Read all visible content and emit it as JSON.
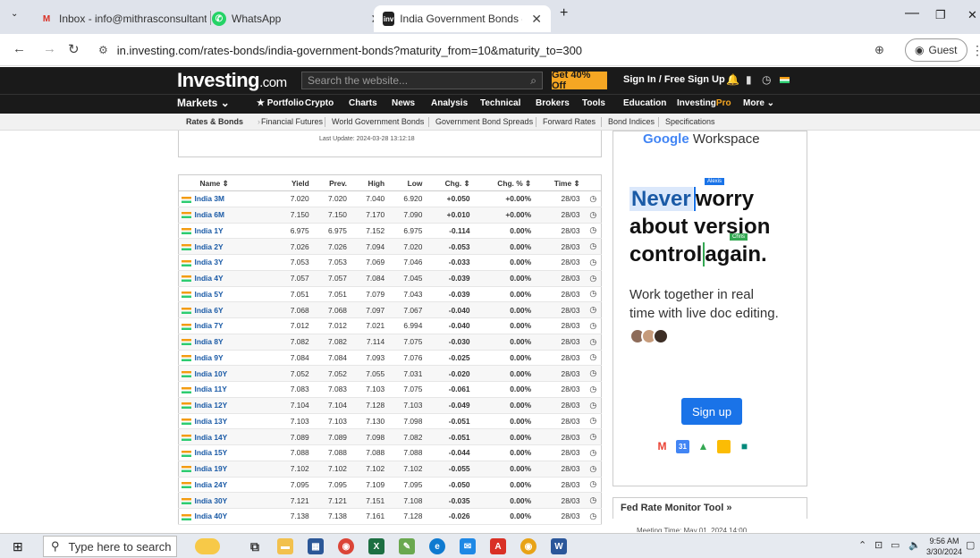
{
  "browser": {
    "tabs": [
      {
        "label": "Inbox - info@mithrasconsultant",
        "icon": "gmail-icon"
      },
      {
        "label": "WhatsApp",
        "icon": "whatsapp-icon"
      },
      {
        "label": "India Government Bonds - Inve",
        "icon": "investing-icon",
        "active": true
      }
    ],
    "new_tab": "+",
    "url": "in.investing.com/rates-bonds/india-government-bonds?maturity_from=10&maturity_to=300",
    "profile": "Guest",
    "window": {
      "minimize": "—",
      "maximize": "❐",
      "close": "✕"
    }
  },
  "site": {
    "logo_main": "Investing",
    "logo_suffix": ".com",
    "search_placeholder": "Search the website...",
    "offer": "Get 40% Off",
    "signin": "Sign In / Free Sign Up",
    "nav": {
      "markets": "Markets ⌄",
      "portfolio": "★ Portfolio",
      "crypto": "Crypto",
      "charts": "Charts",
      "news": "News",
      "analysis": "Analysis",
      "technical": "Technical",
      "brokers": "Brokers",
      "tools": "Tools",
      "education": "Education",
      "investing_pro_a": "Investing",
      "investing_pro_b": "Pro",
      "more": "More ⌄"
    },
    "subnav": [
      "Rates & Bonds",
      "Financial Futures",
      "World Government Bonds",
      "Government Bond Spreads",
      "Forward Rates",
      "Bond Indices",
      "Specifications"
    ],
    "last_update": "Last Update: 2024-03-28 13:12:18"
  },
  "table": {
    "headers": {
      "name": "Name ⇕",
      "yield": "Yield",
      "prev": "Prev.",
      "high": "High",
      "low": "Low",
      "chg": "Chg. ⇕",
      "chgp": "Chg. % ⇕",
      "time": "Time ⇕"
    },
    "rows": [
      {
        "name": "India 3M",
        "yield": "7.020",
        "prev": "7.020",
        "high": "7.040",
        "low": "6.920",
        "chg": "+0.050",
        "chgp": "+0.00%",
        "time": "28/03",
        "dir": "pos"
      },
      {
        "name": "India 6M",
        "yield": "7.150",
        "prev": "7.150",
        "high": "7.170",
        "low": "7.090",
        "chg": "+0.010",
        "chgp": "+0.00%",
        "time": "28/03",
        "dir": "pos"
      },
      {
        "name": "India 1Y",
        "yield": "6.975",
        "prev": "6.975",
        "high": "7.152",
        "low": "6.975",
        "chg": "-0.114",
        "chgp": "0.00%",
        "time": "28/03",
        "dir": "neg"
      },
      {
        "name": "India 2Y",
        "yield": "7.026",
        "prev": "7.026",
        "high": "7.094",
        "low": "7.020",
        "chg": "-0.053",
        "chgp": "0.00%",
        "time": "28/03",
        "dir": "neg"
      },
      {
        "name": "India 3Y",
        "yield": "7.053",
        "prev": "7.053",
        "high": "7.069",
        "low": "7.046",
        "chg": "-0.033",
        "chgp": "0.00%",
        "time": "28/03",
        "dir": "neg"
      },
      {
        "name": "India 4Y",
        "yield": "7.057",
        "prev": "7.057",
        "high": "7.084",
        "low": "7.045",
        "chg": "-0.039",
        "chgp": "0.00%",
        "time": "28/03",
        "dir": "neg"
      },
      {
        "name": "India 5Y",
        "yield": "7.051",
        "prev": "7.051",
        "high": "7.079",
        "low": "7.043",
        "chg": "-0.039",
        "chgp": "0.00%",
        "time": "28/03",
        "dir": "neg"
      },
      {
        "name": "India 6Y",
        "yield": "7.068",
        "prev": "7.068",
        "high": "7.097",
        "low": "7.067",
        "chg": "-0.040",
        "chgp": "0.00%",
        "time": "28/03",
        "dir": "neg"
      },
      {
        "name": "India 7Y",
        "yield": "7.012",
        "prev": "7.012",
        "high": "7.021",
        "low": "6.994",
        "chg": "-0.040",
        "chgp": "0.00%",
        "time": "28/03",
        "dir": "neg"
      },
      {
        "name": "India 8Y",
        "yield": "7.082",
        "prev": "7.082",
        "high": "7.114",
        "low": "7.075",
        "chg": "-0.030",
        "chgp": "0.00%",
        "time": "28/03",
        "dir": "neg"
      },
      {
        "name": "India 9Y",
        "yield": "7.084",
        "prev": "7.084",
        "high": "7.093",
        "low": "7.076",
        "chg": "-0.025",
        "chgp": "0.00%",
        "time": "28/03",
        "dir": "neg"
      },
      {
        "name": "India 10Y",
        "yield": "7.052",
        "prev": "7.052",
        "high": "7.055",
        "low": "7.031",
        "chg": "-0.020",
        "chgp": "0.00%",
        "time": "28/03",
        "dir": "neg"
      },
      {
        "name": "India 11Y",
        "yield": "7.083",
        "prev": "7.083",
        "high": "7.103",
        "low": "7.075",
        "chg": "-0.061",
        "chgp": "0.00%",
        "time": "28/03",
        "dir": "neg"
      },
      {
        "name": "India 12Y",
        "yield": "7.104",
        "prev": "7.104",
        "high": "7.128",
        "low": "7.103",
        "chg": "-0.049",
        "chgp": "0.00%",
        "time": "28/03",
        "dir": "neg"
      },
      {
        "name": "India 13Y",
        "yield": "7.103",
        "prev": "7.103",
        "high": "7.130",
        "low": "7.098",
        "chg": "-0.051",
        "chgp": "0.00%",
        "time": "28/03",
        "dir": "neg"
      },
      {
        "name": "India 14Y",
        "yield": "7.089",
        "prev": "7.089",
        "high": "7.098",
        "low": "7.082",
        "chg": "-0.051",
        "chgp": "0.00%",
        "time": "28/03",
        "dir": "neg"
      },
      {
        "name": "India 15Y",
        "yield": "7.088",
        "prev": "7.088",
        "high": "7.088",
        "low": "7.088",
        "chg": "-0.044",
        "chgp": "0.00%",
        "time": "28/03",
        "dir": "neg"
      },
      {
        "name": "India 19Y",
        "yield": "7.102",
        "prev": "7.102",
        "high": "7.102",
        "low": "7.102",
        "chg": "-0.055",
        "chgp": "0.00%",
        "time": "28/03",
        "dir": "neg"
      },
      {
        "name": "India 24Y",
        "yield": "7.095",
        "prev": "7.095",
        "high": "7.109",
        "low": "7.095",
        "chg": "-0.050",
        "chgp": "0.00%",
        "time": "28/03",
        "dir": "neg"
      },
      {
        "name": "India 30Y",
        "yield": "7.121",
        "prev": "7.121",
        "high": "7.151",
        "low": "7.108",
        "chg": "-0.035",
        "chgp": "0.00%",
        "time": "28/03",
        "dir": "neg"
      },
      {
        "name": "India 40Y",
        "yield": "7.138",
        "prev": "7.138",
        "high": "7.161",
        "low": "7.128",
        "chg": "-0.026",
        "chgp": "0.00%",
        "time": "28/03",
        "dir": "neg"
      }
    ]
  },
  "ad": {
    "brand_a": "Google",
    "brand_b": " Workspace",
    "cursor1": "Alexis",
    "cursor2": "Chris",
    "head_l1_hl": "Never",
    "head_l1_rest": "worry",
    "head_l2": "about version",
    "head_l3_a": "control",
    "head_l3_b": "again.",
    "sub_l1": "Work together in real",
    "sub_l2": "time with live doc editing.",
    "cta": "Sign up"
  },
  "fed": {
    "title": "Fed Rate Monitor Tool »",
    "meeting": "Meeting Time:  May 01, 2024 14:00"
  },
  "taskbar": {
    "search_placeholder": "Type here to search",
    "time": "9:56 AM",
    "date": "3/30/2024"
  },
  "colors": {
    "positive": "#0a9a2b",
    "negative": "#d0141f",
    "link": "#1a5aa6",
    "offer": "#f5a623",
    "header_bg": "#1a1a1a"
  }
}
